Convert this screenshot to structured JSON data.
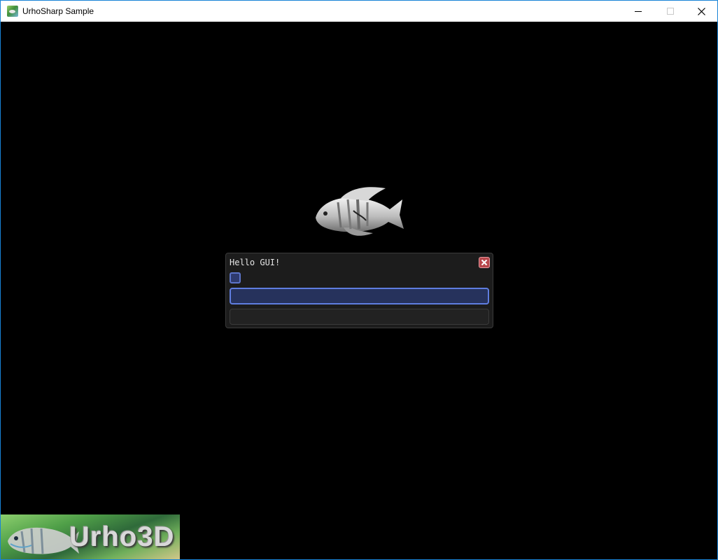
{
  "window": {
    "title": "UrhoSharp Sample",
    "app_icon": "urho-fish-icon",
    "controls": [
      "minimize-icon",
      "maximize-icon",
      "close-icon"
    ],
    "accent": "#1883d7"
  },
  "scene": {
    "background": "#000000",
    "model": "fish-model"
  },
  "gui_panel": {
    "title": "Hello GUI!",
    "close_icon": "close-box-icon",
    "checkbox": {
      "checked": false
    },
    "text_input_1": {
      "value": "",
      "focused": true
    },
    "text_input_2": {
      "value": "",
      "focused": false
    },
    "colors": {
      "panel": "#1c1c1c",
      "accent": "#5f7ddf",
      "close": "#b8484c"
    }
  },
  "logo": {
    "text": "Urho3D",
    "image": "urho3d-logo"
  }
}
